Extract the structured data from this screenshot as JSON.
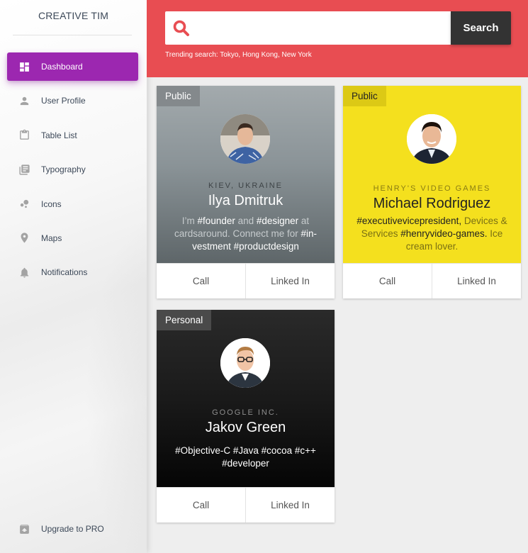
{
  "sidebar": {
    "brand": "CREATIVE TIM",
    "items": [
      {
        "label": "Dashboard",
        "icon": "dashboard-icon",
        "active": true
      },
      {
        "label": "User Profile",
        "icon": "person-icon"
      },
      {
        "label": "Table List",
        "icon": "clipboard-icon"
      },
      {
        "label": "Typography",
        "icon": "library-books-icon"
      },
      {
        "label": "Icons",
        "icon": "bubble-chart-icon"
      },
      {
        "label": "Maps",
        "icon": "location-pin-icon"
      },
      {
        "label": "Notifications",
        "icon": "bell-icon"
      }
    ],
    "upgrade": {
      "label": "Upgrade to PRO",
      "icon": "unarchive-icon"
    }
  },
  "header": {
    "search_placeholder": "",
    "search_button": "Search",
    "trending": "Trending search: Tokyo, Hong Kong, New York",
    "accent": "#e84d52"
  },
  "cards": [
    {
      "tag": "Public",
      "company": "KIEV, UKRAINE",
      "name": "Ilya Dmitruk",
      "bio": [
        {
          "t": "I’m ",
          "h": false
        },
        {
          "t": "#founder",
          "h": true
        },
        {
          "t": " and ",
          "h": false
        },
        {
          "t": "#designer",
          "h": true
        },
        {
          "t": " at cardsaround. Connect me for ",
          "h": false
        },
        {
          "t": "#in-vestment",
          "h": true
        },
        {
          "t": " ",
          "h": false
        },
        {
          "t": "#productdesign",
          "h": true
        }
      ],
      "actions": [
        "Call",
        "Linked In"
      ]
    },
    {
      "tag": "Public",
      "company": "HENRY'S VIDEO GAMES",
      "name": "Michael Rodriguez",
      "bio": [
        {
          "t": "#executivevicepresident,",
          "h": true
        },
        {
          "t": " Devices & Services ",
          "h": false
        },
        {
          "t": "#henryvideo-games.",
          "h": true
        },
        {
          "t": " Ice cream lover.",
          "h": false
        }
      ],
      "actions": [
        "Call",
        "Linked In"
      ]
    },
    {
      "tag": "Personal",
      "company": "GOOGLE INC.",
      "name": "Jakov Green",
      "bio": [
        {
          "t": "#Objective-C #Java #cocoa #c++ #developer",
          "h": false
        }
      ],
      "actions": [
        "Call",
        "Linked In"
      ]
    }
  ]
}
